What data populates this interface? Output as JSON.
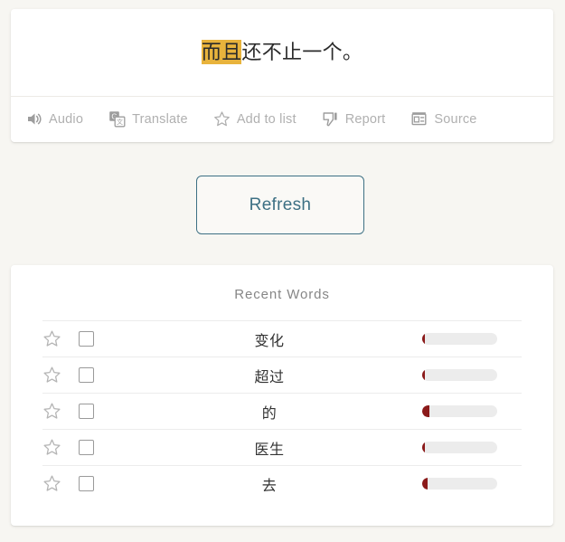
{
  "sentence_card": {
    "text_before": "",
    "highlighted": "而且",
    "text_after": "还不止一个。",
    "full_text": "而且还不止一个。",
    "highlight_color": "#e8b33c",
    "toolbar": [
      {
        "label": "Audio",
        "icon": "speaker-icon"
      },
      {
        "label": "Translate",
        "icon": "google-translate-icon"
      },
      {
        "label": "Add to list",
        "icon": "star-outline-icon"
      },
      {
        "label": "Report",
        "icon": "thumbs-down-icon"
      },
      {
        "label": "Source",
        "icon": "newspaper-icon"
      }
    ]
  },
  "refresh": {
    "label": "Refresh",
    "accent_color": "#3d7084"
  },
  "recent_words": {
    "title": "Recent Words",
    "bar_color": "#8b1a1a",
    "bar_track_color": "#ececec",
    "rows": [
      {
        "word": "变化",
        "progress_percent": 4,
        "starred": false,
        "checked": false
      },
      {
        "word": "超过",
        "progress_percent": 4,
        "starred": false,
        "checked": false
      },
      {
        "word": "的",
        "progress_percent": 10,
        "starred": false,
        "checked": false
      },
      {
        "word": "医生",
        "progress_percent": 4,
        "starred": false,
        "checked": false
      },
      {
        "word": "去",
        "progress_percent": 7,
        "starred": false,
        "checked": false
      }
    ]
  }
}
